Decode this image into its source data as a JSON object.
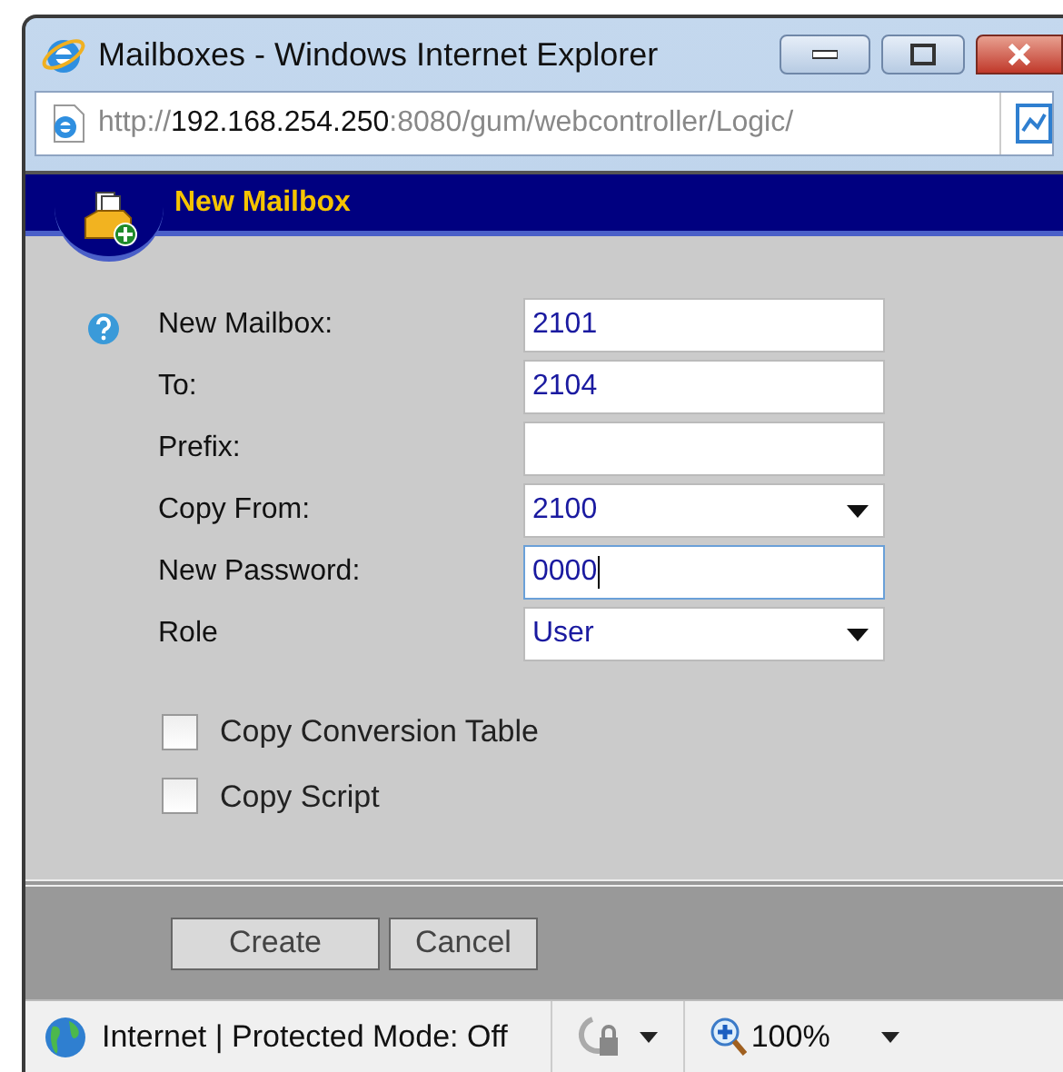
{
  "window": {
    "title": "Mailboxes - Windows Internet Explorer"
  },
  "address_bar": {
    "scheme": "http://",
    "host": "192.168.254.250",
    "rest": ":8080/gum/webcontroller/Logic/"
  },
  "dialog": {
    "title": "New Mailbox"
  },
  "fields": [
    {
      "label": "New Mailbox:",
      "kind": "text",
      "value": "2101",
      "focused": false
    },
    {
      "label": "To:",
      "kind": "text",
      "value": "2104",
      "focused": false
    },
    {
      "label": "Prefix:",
      "kind": "text",
      "focused": false
    },
    {
      "label": "Copy From:",
      "kind": "select",
      "value": "2100",
      "focused": false
    },
    {
      "label": "New Password:",
      "kind": "text",
      "value": "0000",
      "focused": true
    },
    {
      "label": "Role",
      "kind": "select",
      "value": "User",
      "focused": false
    }
  ],
  "checkboxes": [
    {
      "label": "Copy Conversion Table",
      "checked": false
    },
    {
      "label": "Copy Script",
      "checked": false
    }
  ],
  "buttons": [
    "Create",
    "Cancel"
  ],
  "status_bar": {
    "zone": "Internet | Protected Mode: Off",
    "zoom": "100%"
  }
}
